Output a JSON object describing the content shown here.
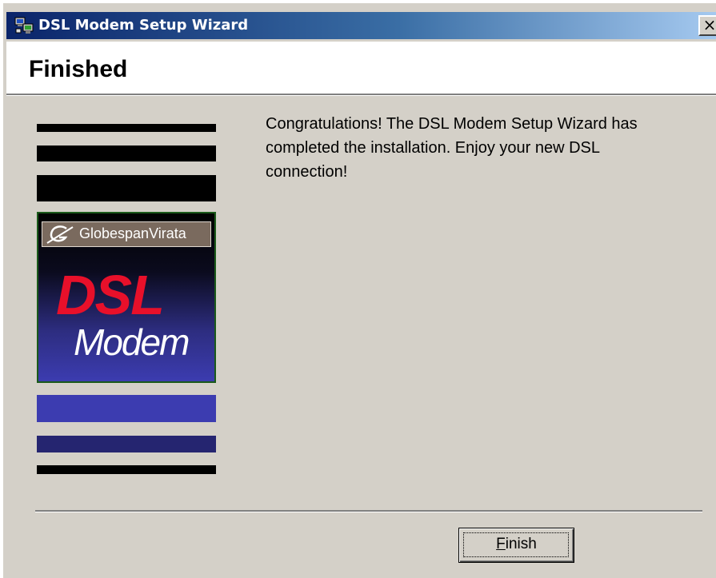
{
  "window": {
    "title": "DSL Modem Setup Wizard",
    "close_label": "×"
  },
  "header": {
    "title": "Finished"
  },
  "logo": {
    "company": "GlobespanVirata",
    "product_line1": "DSL",
    "product_line2": "Modem"
  },
  "message": {
    "text": "Congratulations!  The DSL Modem Setup Wizard has completed the installation.  Enjoy your new DSL connection!"
  },
  "buttons": {
    "finish_mnemonic": "F",
    "finish_rest": "inish"
  },
  "colors": {
    "titlebar_start": "#0a246a",
    "titlebar_end": "#a6caf0",
    "dialog_bg": "#d4d0c8",
    "stripe_black": "#000000",
    "stripe_blue": "#3c3cb0",
    "logo_red": "#e8102a"
  },
  "icons": {
    "title_icon": "computer-network-icon",
    "close_icon": "close-icon"
  }
}
